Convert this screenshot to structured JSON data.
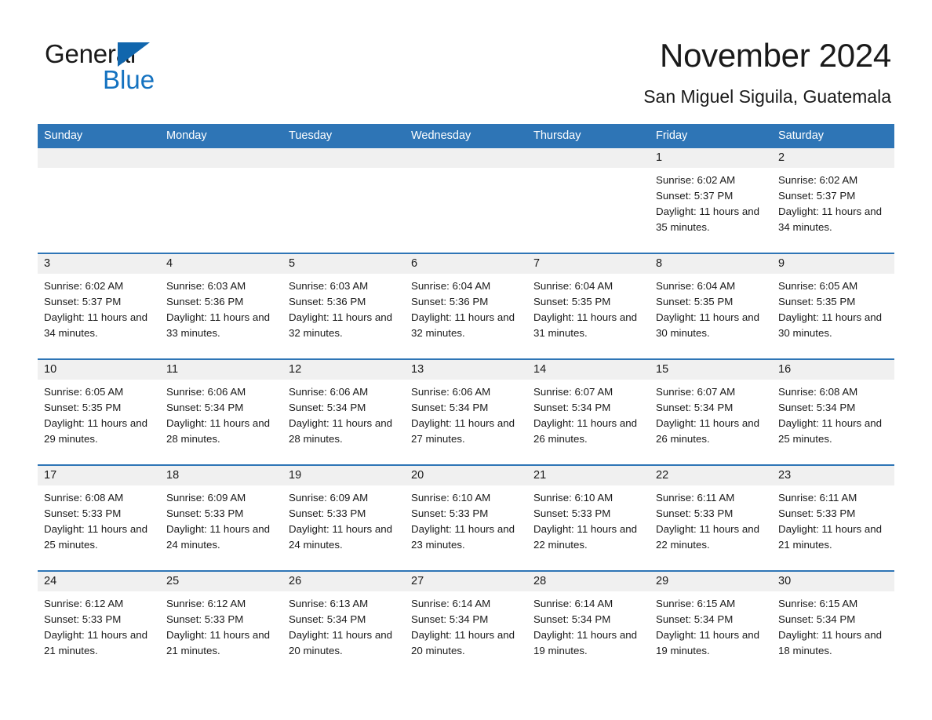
{
  "brand": {
    "name_part1": "General",
    "name_part2": "Blue",
    "triangle_icon": "triangle-logo-icon",
    "accent_color": "#1472c0"
  },
  "header": {
    "title": "November 2024",
    "subtitle": "San Miguel Siguila, Guatemala"
  },
  "theme": {
    "header_blue": "#2e75b6",
    "daynum_band": "#f0f0f0",
    "text": "#1a1a1a"
  },
  "weekday_headers": [
    "Sunday",
    "Monday",
    "Tuesday",
    "Wednesday",
    "Thursday",
    "Friday",
    "Saturday"
  ],
  "weeks": [
    [
      {
        "day": "",
        "sunrise": "",
        "sunset": "",
        "daylight": ""
      },
      {
        "day": "",
        "sunrise": "",
        "sunset": "",
        "daylight": ""
      },
      {
        "day": "",
        "sunrise": "",
        "sunset": "",
        "daylight": ""
      },
      {
        "day": "",
        "sunrise": "",
        "sunset": "",
        "daylight": ""
      },
      {
        "day": "",
        "sunrise": "",
        "sunset": "",
        "daylight": ""
      },
      {
        "day": "1",
        "sunrise": "Sunrise: 6:02 AM",
        "sunset": "Sunset: 5:37 PM",
        "daylight": "Daylight: 11 hours and 35 minutes."
      },
      {
        "day": "2",
        "sunrise": "Sunrise: 6:02 AM",
        "sunset": "Sunset: 5:37 PM",
        "daylight": "Daylight: 11 hours and 34 minutes."
      }
    ],
    [
      {
        "day": "3",
        "sunrise": "Sunrise: 6:02 AM",
        "sunset": "Sunset: 5:37 PM",
        "daylight": "Daylight: 11 hours and 34 minutes."
      },
      {
        "day": "4",
        "sunrise": "Sunrise: 6:03 AM",
        "sunset": "Sunset: 5:36 PM",
        "daylight": "Daylight: 11 hours and 33 minutes."
      },
      {
        "day": "5",
        "sunrise": "Sunrise: 6:03 AM",
        "sunset": "Sunset: 5:36 PM",
        "daylight": "Daylight: 11 hours and 32 minutes."
      },
      {
        "day": "6",
        "sunrise": "Sunrise: 6:04 AM",
        "sunset": "Sunset: 5:36 PM",
        "daylight": "Daylight: 11 hours and 32 minutes."
      },
      {
        "day": "7",
        "sunrise": "Sunrise: 6:04 AM",
        "sunset": "Sunset: 5:35 PM",
        "daylight": "Daylight: 11 hours and 31 minutes."
      },
      {
        "day": "8",
        "sunrise": "Sunrise: 6:04 AM",
        "sunset": "Sunset: 5:35 PM",
        "daylight": "Daylight: 11 hours and 30 minutes."
      },
      {
        "day": "9",
        "sunrise": "Sunrise: 6:05 AM",
        "sunset": "Sunset: 5:35 PM",
        "daylight": "Daylight: 11 hours and 30 minutes."
      }
    ],
    [
      {
        "day": "10",
        "sunrise": "Sunrise: 6:05 AM",
        "sunset": "Sunset: 5:35 PM",
        "daylight": "Daylight: 11 hours and 29 minutes."
      },
      {
        "day": "11",
        "sunrise": "Sunrise: 6:06 AM",
        "sunset": "Sunset: 5:34 PM",
        "daylight": "Daylight: 11 hours and 28 minutes."
      },
      {
        "day": "12",
        "sunrise": "Sunrise: 6:06 AM",
        "sunset": "Sunset: 5:34 PM",
        "daylight": "Daylight: 11 hours and 28 minutes."
      },
      {
        "day": "13",
        "sunrise": "Sunrise: 6:06 AM",
        "sunset": "Sunset: 5:34 PM",
        "daylight": "Daylight: 11 hours and 27 minutes."
      },
      {
        "day": "14",
        "sunrise": "Sunrise: 6:07 AM",
        "sunset": "Sunset: 5:34 PM",
        "daylight": "Daylight: 11 hours and 26 minutes."
      },
      {
        "day": "15",
        "sunrise": "Sunrise: 6:07 AM",
        "sunset": "Sunset: 5:34 PM",
        "daylight": "Daylight: 11 hours and 26 minutes."
      },
      {
        "day": "16",
        "sunrise": "Sunrise: 6:08 AM",
        "sunset": "Sunset: 5:34 PM",
        "daylight": "Daylight: 11 hours and 25 minutes."
      }
    ],
    [
      {
        "day": "17",
        "sunrise": "Sunrise: 6:08 AM",
        "sunset": "Sunset: 5:33 PM",
        "daylight": "Daylight: 11 hours and 25 minutes."
      },
      {
        "day": "18",
        "sunrise": "Sunrise: 6:09 AM",
        "sunset": "Sunset: 5:33 PM",
        "daylight": "Daylight: 11 hours and 24 minutes."
      },
      {
        "day": "19",
        "sunrise": "Sunrise: 6:09 AM",
        "sunset": "Sunset: 5:33 PM",
        "daylight": "Daylight: 11 hours and 24 minutes."
      },
      {
        "day": "20",
        "sunrise": "Sunrise: 6:10 AM",
        "sunset": "Sunset: 5:33 PM",
        "daylight": "Daylight: 11 hours and 23 minutes."
      },
      {
        "day": "21",
        "sunrise": "Sunrise: 6:10 AM",
        "sunset": "Sunset: 5:33 PM",
        "daylight": "Daylight: 11 hours and 22 minutes."
      },
      {
        "day": "22",
        "sunrise": "Sunrise: 6:11 AM",
        "sunset": "Sunset: 5:33 PM",
        "daylight": "Daylight: 11 hours and 22 minutes."
      },
      {
        "day": "23",
        "sunrise": "Sunrise: 6:11 AM",
        "sunset": "Sunset: 5:33 PM",
        "daylight": "Daylight: 11 hours and 21 minutes."
      }
    ],
    [
      {
        "day": "24",
        "sunrise": "Sunrise: 6:12 AM",
        "sunset": "Sunset: 5:33 PM",
        "daylight": "Daylight: 11 hours and 21 minutes."
      },
      {
        "day": "25",
        "sunrise": "Sunrise: 6:12 AM",
        "sunset": "Sunset: 5:33 PM",
        "daylight": "Daylight: 11 hours and 21 minutes."
      },
      {
        "day": "26",
        "sunrise": "Sunrise: 6:13 AM",
        "sunset": "Sunset: 5:34 PM",
        "daylight": "Daylight: 11 hours and 20 minutes."
      },
      {
        "day": "27",
        "sunrise": "Sunrise: 6:14 AM",
        "sunset": "Sunset: 5:34 PM",
        "daylight": "Daylight: 11 hours and 20 minutes."
      },
      {
        "day": "28",
        "sunrise": "Sunrise: 6:14 AM",
        "sunset": "Sunset: 5:34 PM",
        "daylight": "Daylight: 11 hours and 19 minutes."
      },
      {
        "day": "29",
        "sunrise": "Sunrise: 6:15 AM",
        "sunset": "Sunset: 5:34 PM",
        "daylight": "Daylight: 11 hours and 19 minutes."
      },
      {
        "day": "30",
        "sunrise": "Sunrise: 6:15 AM",
        "sunset": "Sunset: 5:34 PM",
        "daylight": "Daylight: 11 hours and 18 minutes."
      }
    ]
  ]
}
